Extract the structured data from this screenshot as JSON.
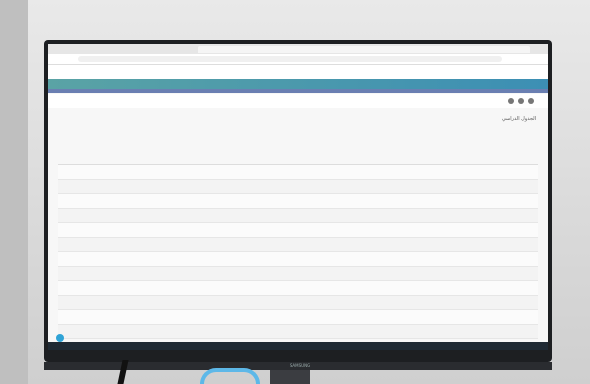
{
  "page": {
    "title": "الجدول الدراسي",
    "filter_label": "",
    "footer_text": "",
    "taskbar_time": ""
  },
  "table": {
    "rows": [
      {
        "seq": ""
      },
      {
        "seq": ""
      },
      {
        "seq": ""
      },
      {
        "seq": ""
      },
      {
        "seq": ""
      },
      {
        "seq": ""
      },
      {
        "seq": ""
      },
      {
        "seq": ""
      },
      {
        "seq": ""
      },
      {
        "seq": ""
      },
      {
        "seq": ""
      },
      {
        "seq": ""
      }
    ]
  },
  "monitor": {
    "brand": "SAMSUNG"
  }
}
